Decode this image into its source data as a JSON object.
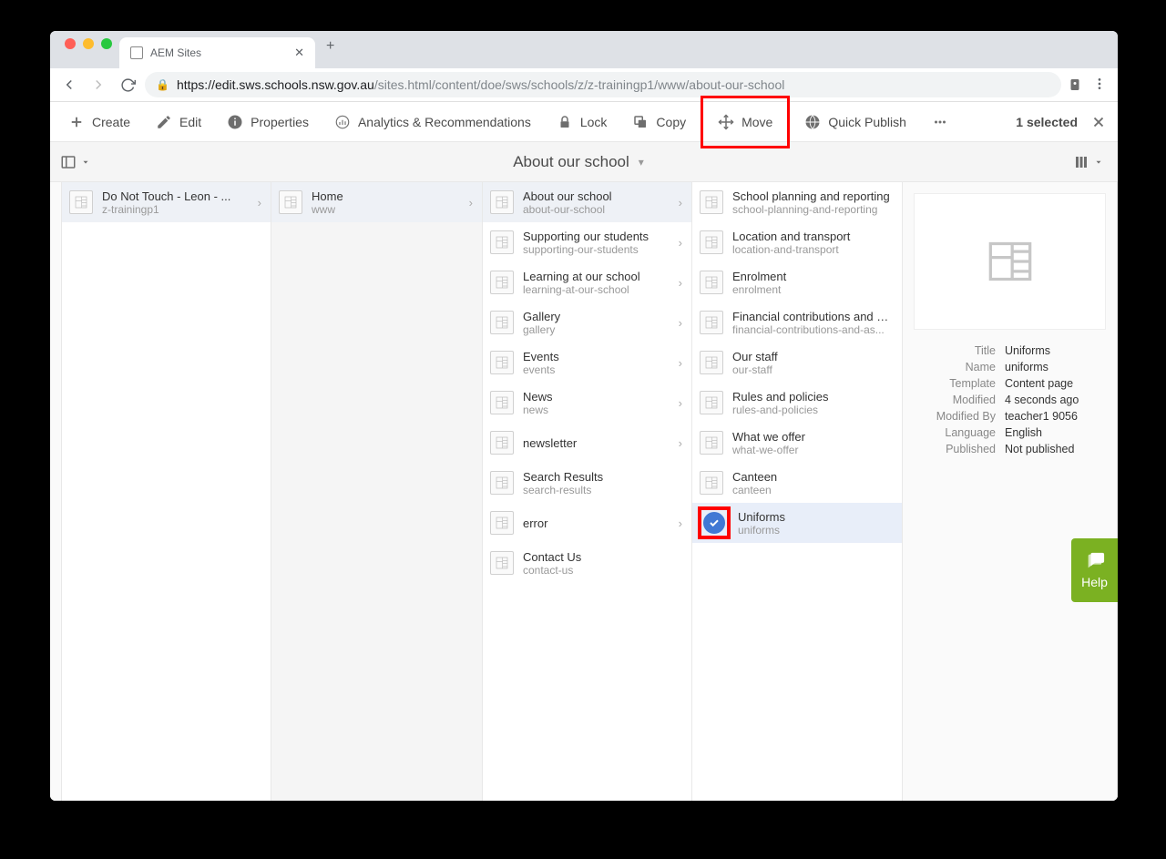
{
  "browser": {
    "tab_title": "AEM Sites",
    "url_host": "https://edit.sws.schools.nsw.gov.au",
    "url_path": "/sites.html/content/doe/sws/schools/z/z-trainingp1/www/about-our-school"
  },
  "toolbar": {
    "create": "Create",
    "edit": "Edit",
    "properties": "Properties",
    "analytics": "Analytics & Recommendations",
    "lock": "Lock",
    "copy": "Copy",
    "move": "Move",
    "quick_publish": "Quick Publish",
    "selected_info": "1 selected"
  },
  "breadcrumb": {
    "title": "About our school"
  },
  "col1": [
    {
      "title": "Do Not Touch - Leon - ...",
      "name": "z-trainingp1",
      "chev": true,
      "active": true
    }
  ],
  "col2": [
    {
      "title": "Home",
      "name": "www",
      "chev": true,
      "active": true
    }
  ],
  "col3": [
    {
      "title": "About our school",
      "name": "about-our-school",
      "chev": true,
      "active": true
    },
    {
      "title": "Supporting our students",
      "name": "supporting-our-students",
      "chev": true
    },
    {
      "title": "Learning at our school",
      "name": "learning-at-our-school",
      "chev": true
    },
    {
      "title": "Gallery",
      "name": "gallery",
      "chev": true
    },
    {
      "title": "Events",
      "name": "events",
      "chev": true
    },
    {
      "title": "News",
      "name": "news",
      "chev": true
    },
    {
      "title": "newsletter",
      "name": "",
      "chev": true
    },
    {
      "title": "Search Results",
      "name": "search-results"
    },
    {
      "title": "error",
      "name": "",
      "chev": true
    },
    {
      "title": "Contact Us",
      "name": "contact-us"
    }
  ],
  "col4": [
    {
      "title": "School planning and reporting",
      "name": "school-planning-and-reporting"
    },
    {
      "title": "Location and transport",
      "name": "location-and-transport"
    },
    {
      "title": "Enrolment",
      "name": "enrolment"
    },
    {
      "title": "Financial contributions and as...",
      "name": "financial-contributions-and-as..."
    },
    {
      "title": "Our staff",
      "name": "our-staff"
    },
    {
      "title": "Rules and policies",
      "name": "rules-and-policies"
    },
    {
      "title": "What we offer",
      "name": "what-we-offer"
    },
    {
      "title": "Canteen",
      "name": "canteen"
    },
    {
      "title": "Uniforms",
      "name": "uniforms",
      "selected": true,
      "redbox": true
    }
  ],
  "detail": {
    "labels": {
      "title": "Title",
      "name": "Name",
      "template": "Template",
      "modified": "Modified",
      "modified_by": "Modified By",
      "language": "Language",
      "published": "Published"
    },
    "values": {
      "title": "Uniforms",
      "name": "uniforms",
      "template": "Content page",
      "modified": "4 seconds ago",
      "modified_by": "teacher1 9056",
      "language": "English",
      "published": "Not published"
    }
  },
  "help": {
    "label": "Help"
  }
}
